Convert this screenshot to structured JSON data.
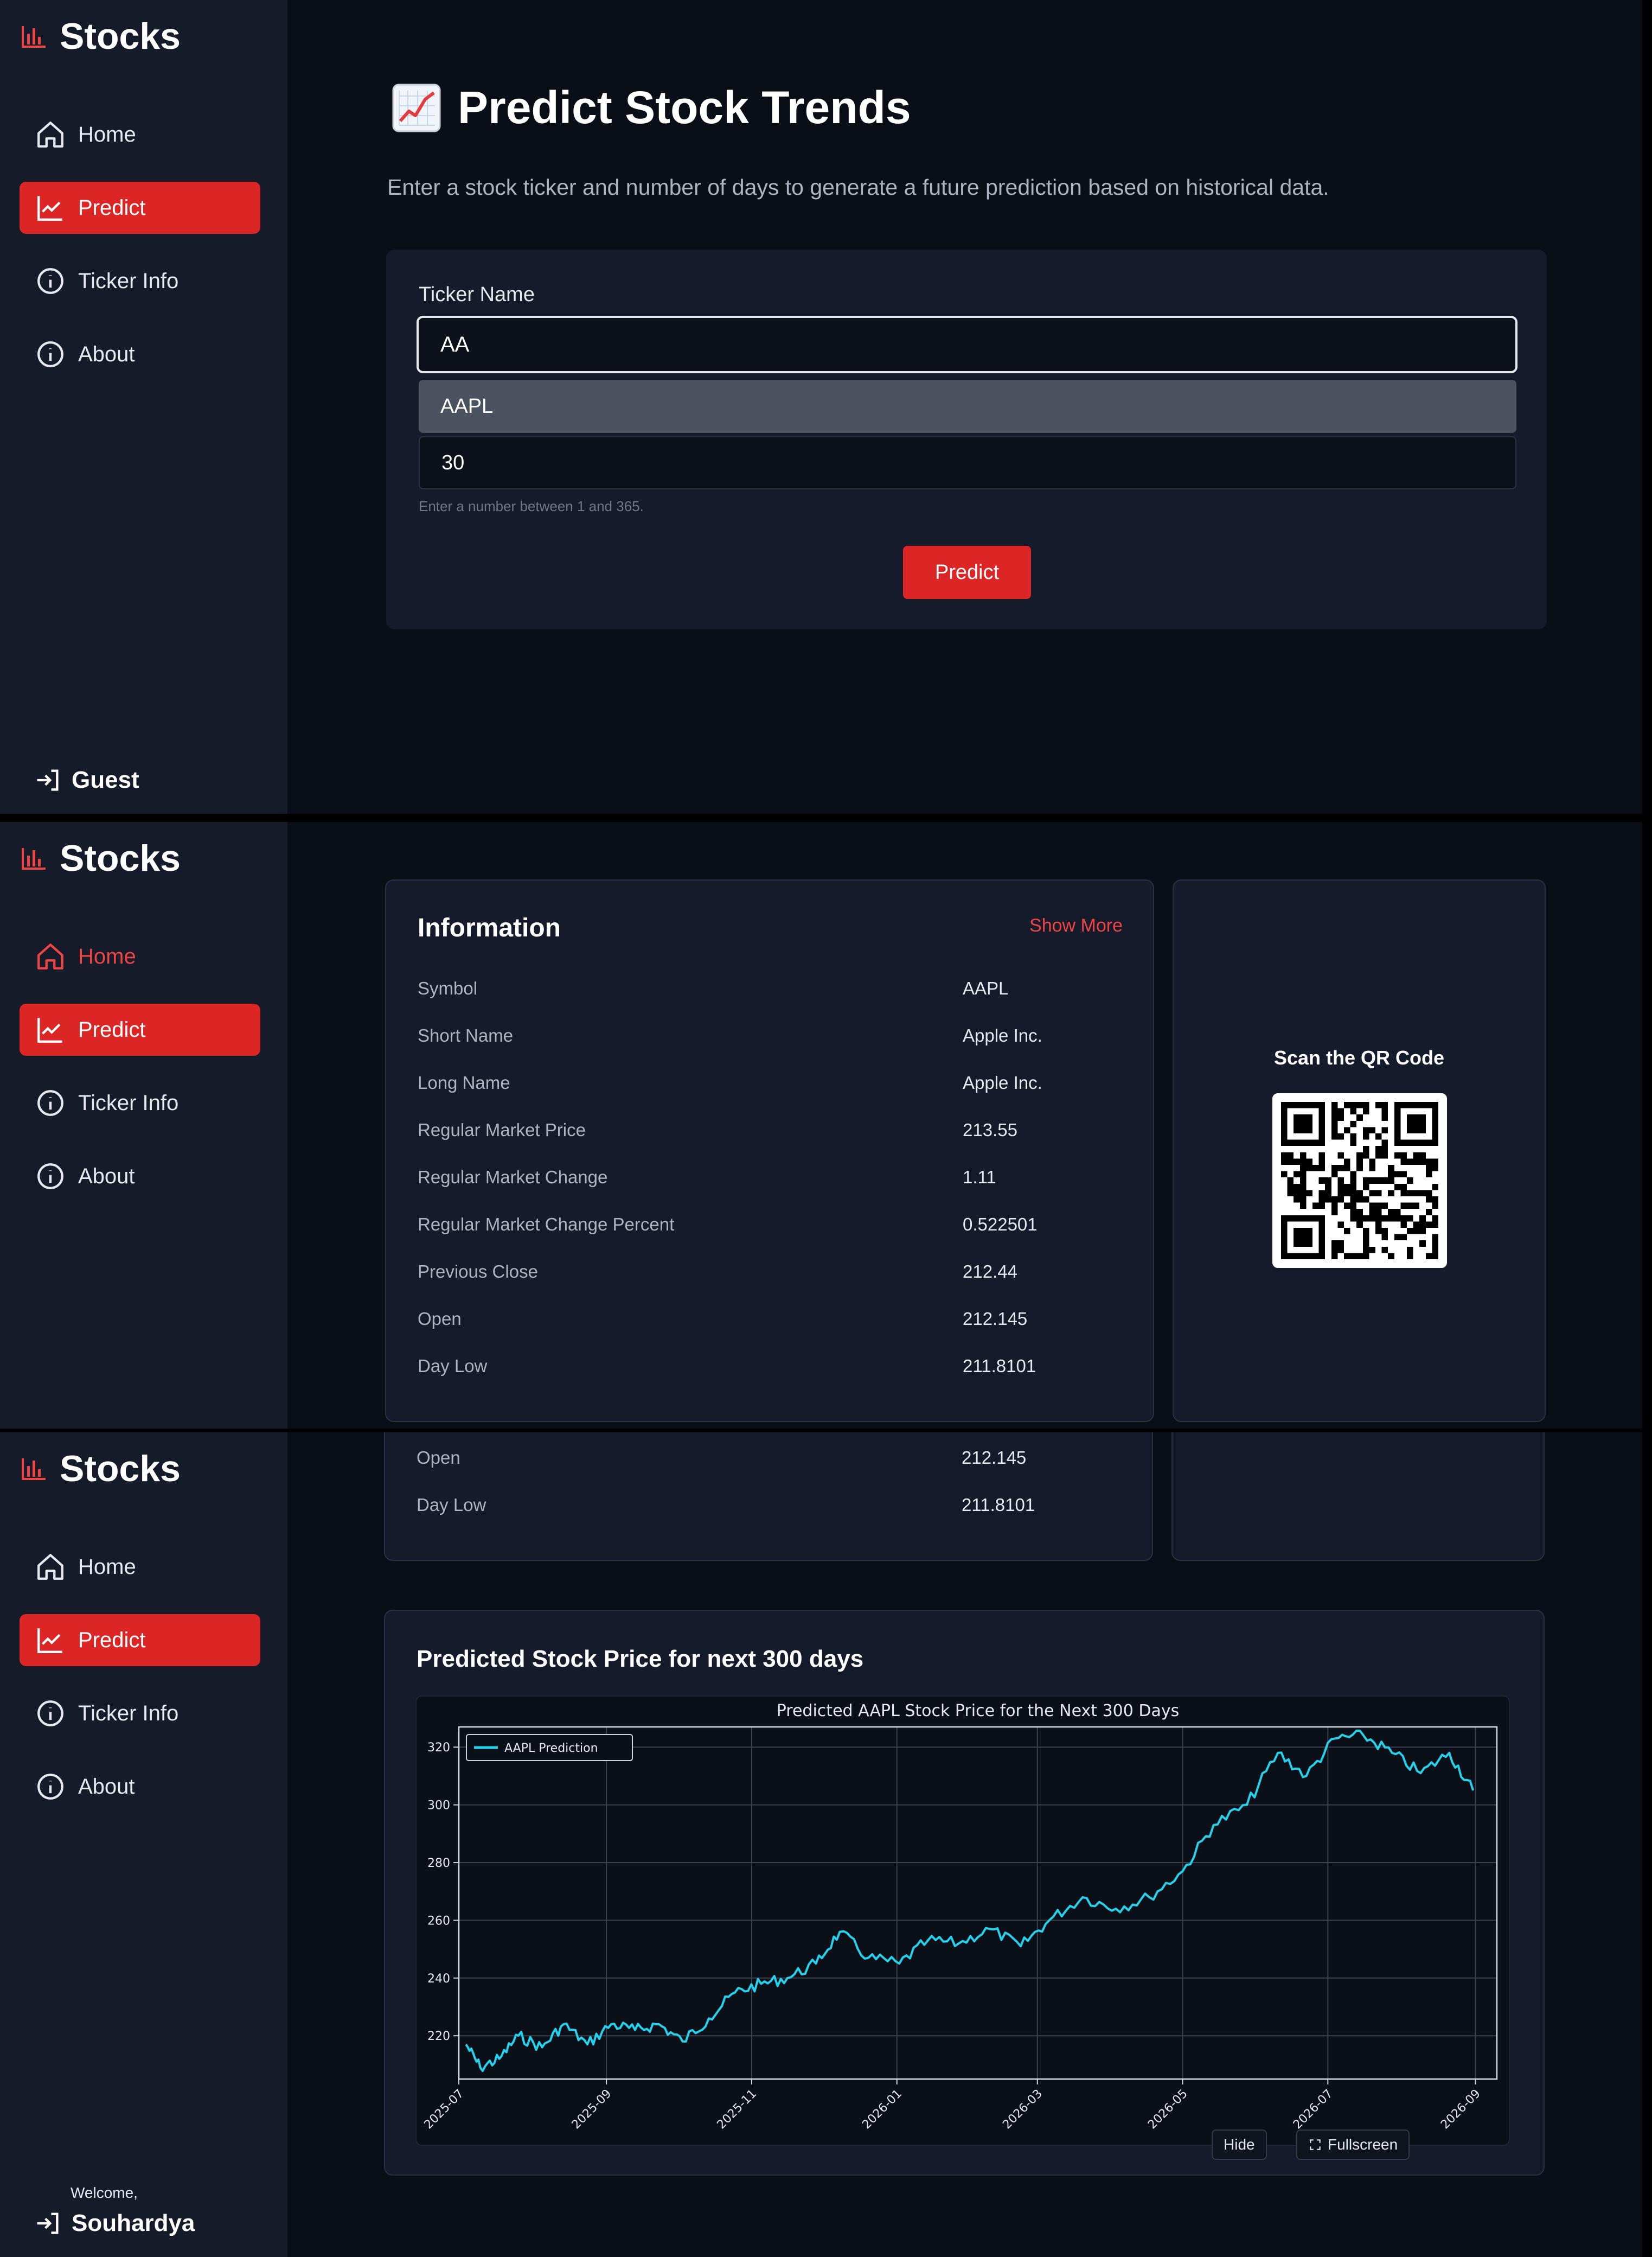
{
  "brand": {
    "name": "Stocks",
    "icon": "bar-chart-icon",
    "accent": "#dc2626"
  },
  "nav": [
    {
      "label": "Home",
      "icon": "home-icon"
    },
    {
      "label": "Predict",
      "icon": "trend-icon"
    },
    {
      "label": "Ticker Info",
      "icon": "info-icon"
    },
    {
      "label": "About",
      "icon": "info-icon"
    }
  ],
  "guest": {
    "label": "Guest",
    "icon": "login-icon"
  },
  "user": {
    "welcome": "Welcome,",
    "name": "Souhardya"
  },
  "predict_page": {
    "title": "Predict Stock Trends",
    "title_icon": "chart-increasing-emoji",
    "subtitle": "Enter a stock ticker and number of days to generate a future prediction based on historical data.",
    "ticker_label": "Ticker Name",
    "ticker_value": "AA",
    "suggestion": "AAPL",
    "days_value": "30",
    "days_hint": "Enter a number between 1 and 365.",
    "button": "Predict"
  },
  "info": {
    "title": "Information",
    "show_more": "Show More",
    "rows": [
      {
        "key": "Symbol",
        "value": "AAPL"
      },
      {
        "key": "Short Name",
        "value": "Apple Inc."
      },
      {
        "key": "Long Name",
        "value": "Apple Inc."
      },
      {
        "key": "Regular Market Price",
        "value": "213.55"
      },
      {
        "key": "Regular Market Change",
        "value": "1.11"
      },
      {
        "key": "Regular Market Change Percent",
        "value": "0.522501"
      },
      {
        "key": "Previous Close",
        "value": "212.44"
      },
      {
        "key": "Open",
        "value": "212.145"
      },
      {
        "key": "Day Low",
        "value": "211.8101"
      }
    ]
  },
  "qr": {
    "title": "Scan the QR Code"
  },
  "prediction": {
    "title": "Predicted Stock Price for next 300 days",
    "hide_label": "Hide",
    "fullscreen_label": "Fullscreen"
  },
  "chart_data": {
    "type": "line",
    "title": "Predicted AAPL Stock Price for the Next 300 Days",
    "xlabel": "",
    "ylabel": "",
    "legend_position": "top-left",
    "grid": true,
    "line_color": "#22d3ee",
    "x_range": [
      "2025-07-01",
      "2026-09-10"
    ],
    "ylim": [
      205,
      327
    ],
    "xticks": [
      "2025-07",
      "2025-09",
      "2025-11",
      "2026-01",
      "2026-03",
      "2026-05",
      "2026-07",
      "2026-09"
    ],
    "yticks": [
      220,
      240,
      260,
      280,
      300,
      320
    ],
    "series": [
      {
        "name": "AAPL Prediction",
        "points": [
          [
            "2025-07-04",
            217
          ],
          [
            "2025-07-10",
            209
          ],
          [
            "2025-07-18",
            212
          ],
          [
            "2025-07-26",
            220
          ],
          [
            "2025-08-05",
            216
          ],
          [
            "2025-08-14",
            224
          ],
          [
            "2025-08-24",
            217
          ],
          [
            "2025-09-03",
            224
          ],
          [
            "2025-09-13",
            222
          ],
          [
            "2025-09-23",
            224
          ],
          [
            "2025-10-03",
            218
          ],
          [
            "2025-10-14",
            226
          ],
          [
            "2025-10-25",
            235
          ],
          [
            "2025-11-05",
            238
          ],
          [
            "2025-11-16",
            240
          ],
          [
            "2025-11-28",
            245
          ],
          [
            "2025-12-08",
            256
          ],
          [
            "2025-12-20",
            247
          ],
          [
            "2026-01-02",
            245
          ],
          [
            "2026-01-14",
            253
          ],
          [
            "2026-01-27",
            252
          ],
          [
            "2026-02-09",
            257
          ],
          [
            "2026-02-22",
            251
          ],
          [
            "2026-03-06",
            260
          ],
          [
            "2026-03-20",
            268
          ],
          [
            "2026-04-03",
            264
          ],
          [
            "2026-04-17",
            268
          ],
          [
            "2026-05-01",
            277
          ],
          [
            "2026-05-14",
            293
          ],
          [
            "2026-05-28",
            300
          ],
          [
            "2026-06-10",
            318
          ],
          [
            "2026-06-22",
            310
          ],
          [
            "2026-07-04",
            323
          ],
          [
            "2026-07-16",
            324
          ],
          [
            "2026-07-28",
            318
          ],
          [
            "2026-08-09",
            311
          ],
          [
            "2026-08-21",
            318
          ],
          [
            "2026-08-31",
            305
          ]
        ]
      }
    ]
  }
}
